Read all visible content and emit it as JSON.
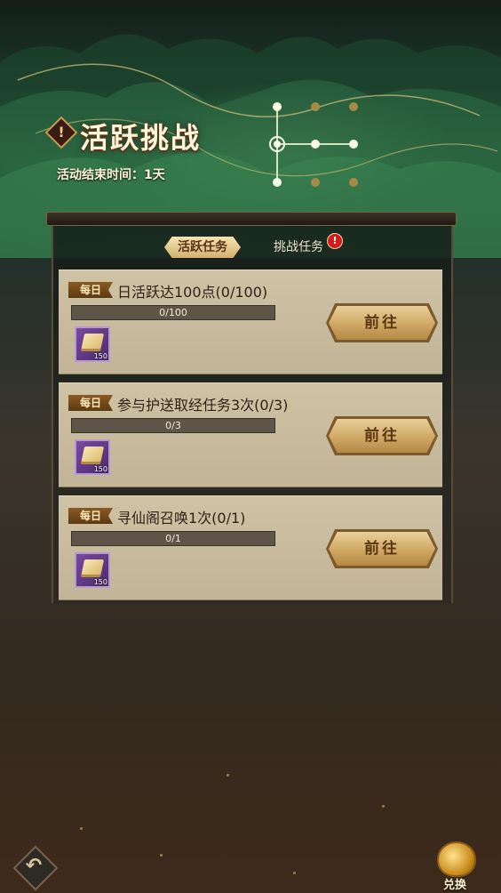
{
  "header": {
    "title": "活跃挑战",
    "title_icon": "exclamation-gem-icon",
    "title_icon_glyph": "!",
    "end_time": "活动结束时间：1天"
  },
  "tabs": {
    "active_label": "活跃任务",
    "challenge_label": "挑战任务",
    "badge_glyph": "!"
  },
  "tasks": [
    {
      "tag": "每日",
      "name": "日活跃达100点(0/100)",
      "progress_text": "0/100",
      "progress": 0,
      "reward_qty": "150",
      "button": "前往"
    },
    {
      "tag": "每日",
      "name": "参与护送取经任务3次(0/3)",
      "progress_text": "0/3",
      "progress": 0,
      "reward_qty": "150",
      "button": "前往"
    },
    {
      "tag": "每日",
      "name": "寻仙阁召唤1次(0/1)",
      "progress_text": "0/1",
      "progress": 0,
      "reward_qty": "150",
      "button": "前往"
    }
  ],
  "footer": {
    "back_icon": "back-arrow-icon",
    "back_glyph": "↶",
    "exchange_label": "兑换",
    "exchange_icon": "treasure-pot-icon"
  },
  "colors": {
    "accent_gold": "#d4b071",
    "badge_red": "#d21b1b",
    "card_bg": "#cfc2a5"
  }
}
